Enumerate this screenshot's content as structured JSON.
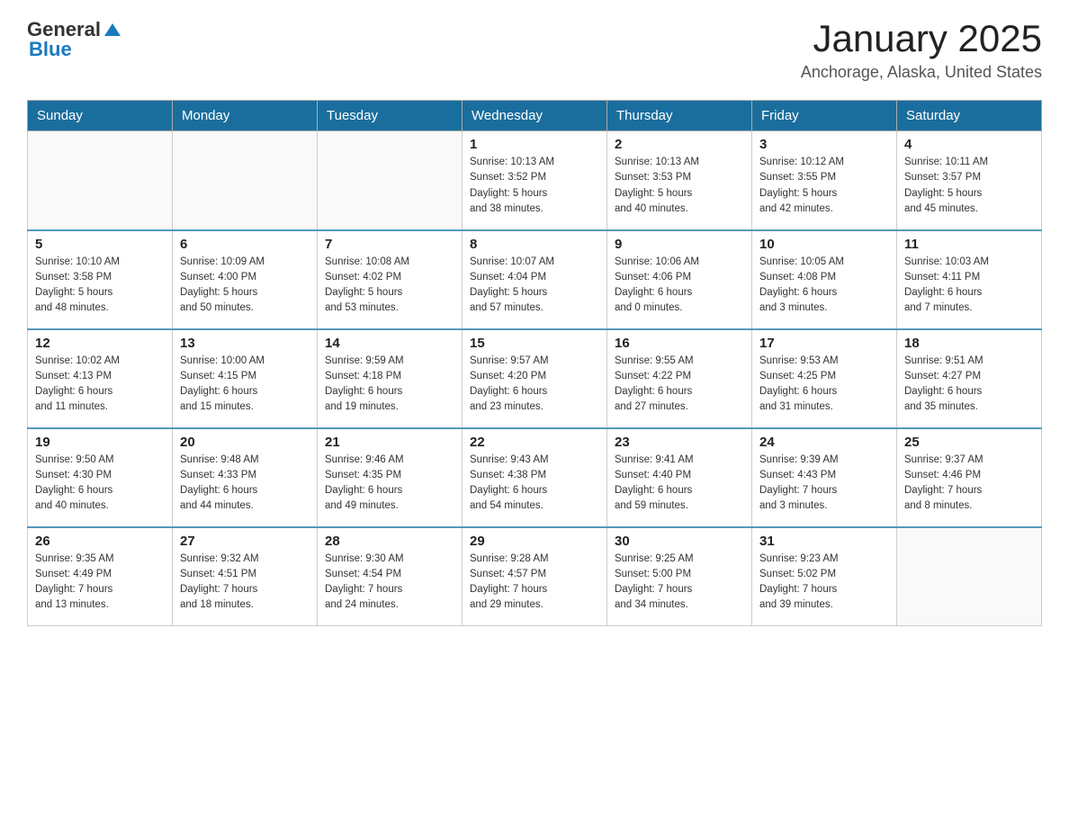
{
  "header": {
    "logo": {
      "general": "General",
      "blue": "Blue"
    },
    "title": "January 2025",
    "subtitle": "Anchorage, Alaska, United States"
  },
  "days_of_week": [
    "Sunday",
    "Monday",
    "Tuesday",
    "Wednesday",
    "Thursday",
    "Friday",
    "Saturday"
  ],
  "weeks": [
    [
      {
        "day": "",
        "info": ""
      },
      {
        "day": "",
        "info": ""
      },
      {
        "day": "",
        "info": ""
      },
      {
        "day": "1",
        "info": "Sunrise: 10:13 AM\nSunset: 3:52 PM\nDaylight: 5 hours\nand 38 minutes."
      },
      {
        "day": "2",
        "info": "Sunrise: 10:13 AM\nSunset: 3:53 PM\nDaylight: 5 hours\nand 40 minutes."
      },
      {
        "day": "3",
        "info": "Sunrise: 10:12 AM\nSunset: 3:55 PM\nDaylight: 5 hours\nand 42 minutes."
      },
      {
        "day": "4",
        "info": "Sunrise: 10:11 AM\nSunset: 3:57 PM\nDaylight: 5 hours\nand 45 minutes."
      }
    ],
    [
      {
        "day": "5",
        "info": "Sunrise: 10:10 AM\nSunset: 3:58 PM\nDaylight: 5 hours\nand 48 minutes."
      },
      {
        "day": "6",
        "info": "Sunrise: 10:09 AM\nSunset: 4:00 PM\nDaylight: 5 hours\nand 50 minutes."
      },
      {
        "day": "7",
        "info": "Sunrise: 10:08 AM\nSunset: 4:02 PM\nDaylight: 5 hours\nand 53 minutes."
      },
      {
        "day": "8",
        "info": "Sunrise: 10:07 AM\nSunset: 4:04 PM\nDaylight: 5 hours\nand 57 minutes."
      },
      {
        "day": "9",
        "info": "Sunrise: 10:06 AM\nSunset: 4:06 PM\nDaylight: 6 hours\nand 0 minutes."
      },
      {
        "day": "10",
        "info": "Sunrise: 10:05 AM\nSunset: 4:08 PM\nDaylight: 6 hours\nand 3 minutes."
      },
      {
        "day": "11",
        "info": "Sunrise: 10:03 AM\nSunset: 4:11 PM\nDaylight: 6 hours\nand 7 minutes."
      }
    ],
    [
      {
        "day": "12",
        "info": "Sunrise: 10:02 AM\nSunset: 4:13 PM\nDaylight: 6 hours\nand 11 minutes."
      },
      {
        "day": "13",
        "info": "Sunrise: 10:00 AM\nSunset: 4:15 PM\nDaylight: 6 hours\nand 15 minutes."
      },
      {
        "day": "14",
        "info": "Sunrise: 9:59 AM\nSunset: 4:18 PM\nDaylight: 6 hours\nand 19 minutes."
      },
      {
        "day": "15",
        "info": "Sunrise: 9:57 AM\nSunset: 4:20 PM\nDaylight: 6 hours\nand 23 minutes."
      },
      {
        "day": "16",
        "info": "Sunrise: 9:55 AM\nSunset: 4:22 PM\nDaylight: 6 hours\nand 27 minutes."
      },
      {
        "day": "17",
        "info": "Sunrise: 9:53 AM\nSunset: 4:25 PM\nDaylight: 6 hours\nand 31 minutes."
      },
      {
        "day": "18",
        "info": "Sunrise: 9:51 AM\nSunset: 4:27 PM\nDaylight: 6 hours\nand 35 minutes."
      }
    ],
    [
      {
        "day": "19",
        "info": "Sunrise: 9:50 AM\nSunset: 4:30 PM\nDaylight: 6 hours\nand 40 minutes."
      },
      {
        "day": "20",
        "info": "Sunrise: 9:48 AM\nSunset: 4:33 PM\nDaylight: 6 hours\nand 44 minutes."
      },
      {
        "day": "21",
        "info": "Sunrise: 9:46 AM\nSunset: 4:35 PM\nDaylight: 6 hours\nand 49 minutes."
      },
      {
        "day": "22",
        "info": "Sunrise: 9:43 AM\nSunset: 4:38 PM\nDaylight: 6 hours\nand 54 minutes."
      },
      {
        "day": "23",
        "info": "Sunrise: 9:41 AM\nSunset: 4:40 PM\nDaylight: 6 hours\nand 59 minutes."
      },
      {
        "day": "24",
        "info": "Sunrise: 9:39 AM\nSunset: 4:43 PM\nDaylight: 7 hours\nand 3 minutes."
      },
      {
        "day": "25",
        "info": "Sunrise: 9:37 AM\nSunset: 4:46 PM\nDaylight: 7 hours\nand 8 minutes."
      }
    ],
    [
      {
        "day": "26",
        "info": "Sunrise: 9:35 AM\nSunset: 4:49 PM\nDaylight: 7 hours\nand 13 minutes."
      },
      {
        "day": "27",
        "info": "Sunrise: 9:32 AM\nSunset: 4:51 PM\nDaylight: 7 hours\nand 18 minutes."
      },
      {
        "day": "28",
        "info": "Sunrise: 9:30 AM\nSunset: 4:54 PM\nDaylight: 7 hours\nand 24 minutes."
      },
      {
        "day": "29",
        "info": "Sunrise: 9:28 AM\nSunset: 4:57 PM\nDaylight: 7 hours\nand 29 minutes."
      },
      {
        "day": "30",
        "info": "Sunrise: 9:25 AM\nSunset: 5:00 PM\nDaylight: 7 hours\nand 34 minutes."
      },
      {
        "day": "31",
        "info": "Sunrise: 9:23 AM\nSunset: 5:02 PM\nDaylight: 7 hours\nand 39 minutes."
      },
      {
        "day": "",
        "info": ""
      }
    ]
  ]
}
